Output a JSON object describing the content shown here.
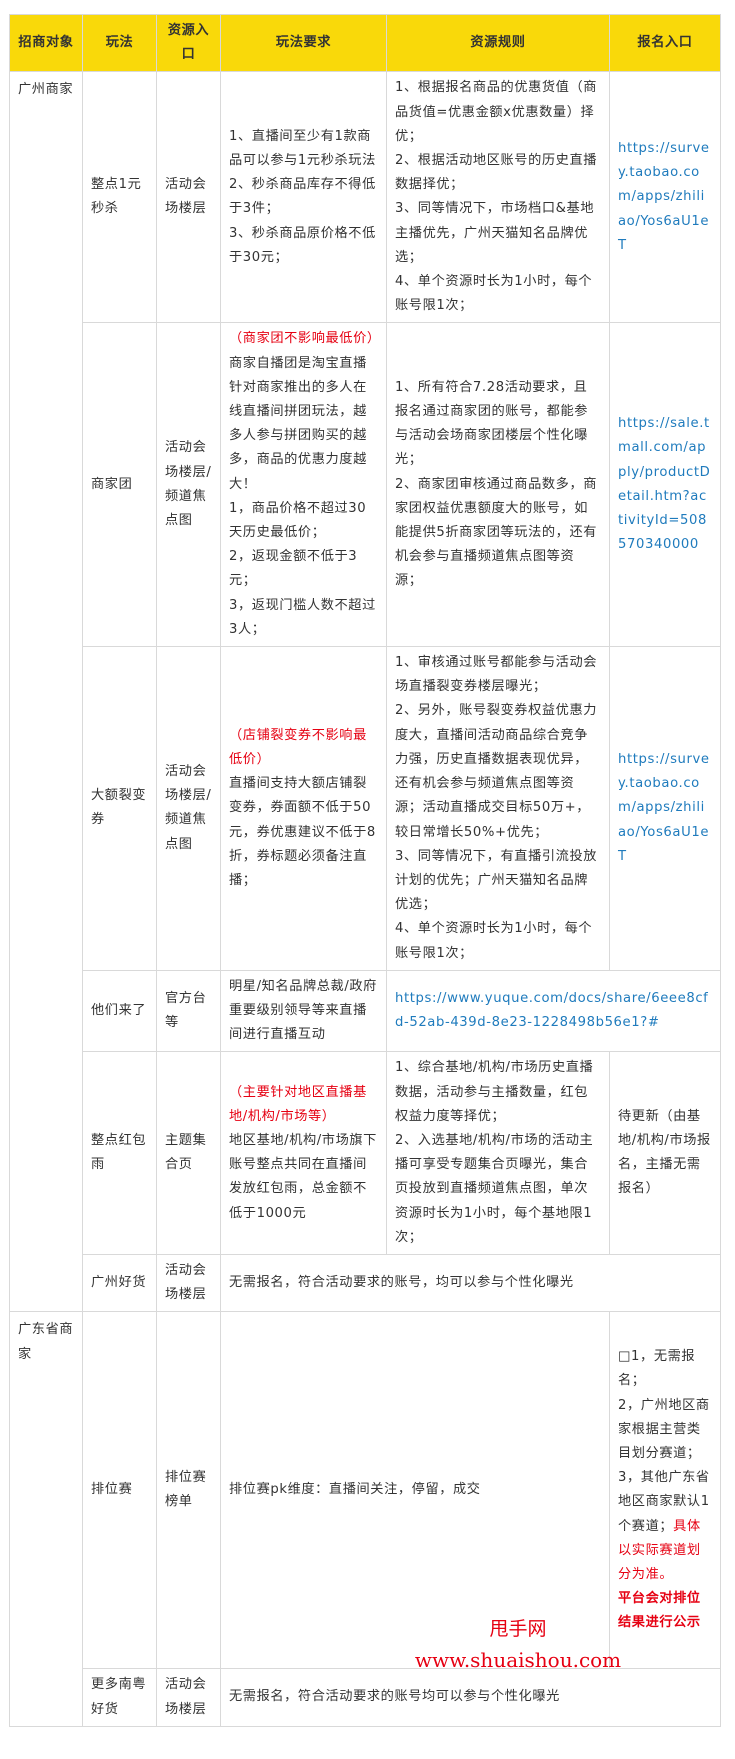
{
  "headers": [
    "招商对象",
    "玩法",
    "资源入口",
    "玩法要求",
    "资源规则",
    "报名入口"
  ],
  "groups": {
    "gz": "广州商家",
    "gd": "广东省商家"
  },
  "rows": [
    {
      "play": "整点1元秒杀",
      "entry": "活动会场楼层",
      "req": [
        "1、直播间至少有1款商品可以参与1元秒杀玩法",
        "2、秒杀商品库存不得低于3件；",
        "3、秒杀商品原价格不低于30元；"
      ],
      "rules": [
        "1、根据报名商品的优惠货值（商品货值=优惠金额x优惠数量）择优；",
        "2、根据活动地区账号的历史直播数据择优；",
        "3、同等情况下，市场档口&基地主播优先，广州天猫知名品牌优选；",
        "4、单个资源时长为1小时，每个账号限1次；"
      ],
      "link": "https://survey.taobao.com/apps/zhiliao/Yos6aU1eT"
    },
    {
      "play": "商家团",
      "entry": "活动会场楼层/频道焦点图",
      "req_note": "（商家团不影响最低价）",
      "req": [
        "商家自播团是淘宝直播针对商家推出的多人在线直播间拼团玩法，越多人参与拼团购买的越多，商品的优惠力度越大！",
        "1，商品价格不超过30天历史最低价；",
        "2，返现金额不低于3元；",
        "3，返现门槛人数不超过3人；"
      ],
      "rules": [
        "1、所有符合7.28活动要求，且报名通过商家团的账号，都能参与活动会场商家团楼层个性化曝光；",
        "2、商家团审核通过商品数多，商家团权益优惠额度大的账号，如能提供5折商家团等玩法的，还有机会参与直播频道焦点图等资源；"
      ],
      "link": "https://sale.tmall.com/apply/productDetail.htm?activityId=508570340000"
    },
    {
      "play": "大额裂变券",
      "entry": "活动会场楼层/频道焦点图",
      "req_note": "（店铺裂变券不影响最低价）",
      "req": [
        "直播间支持大额店铺裂变券，券面额不低于50元，券优惠建议不低于8折，券标题必须备注直播；"
      ],
      "rules": [
        "1、审核通过账号都能参与活动会场直播裂变券楼层曝光；",
        "2、另外，账号裂变券权益优惠力度大，直播间活动商品综合竞争力强，历史直播数据表现优异，还有机会参与频道焦点图等资源；活动直播成交目标50万+，较日常增长50%+优先；",
        "3、同等情况下，有直播引流投放计划的优先；广州天猫知名品牌优选；",
        "4、单个资源时长为1小时，每个账号限1次；"
      ],
      "link": "https://survey.taobao.com/apps/zhiliao/Yos6aU1eT"
    },
    {
      "play": "他们来了",
      "entry": "官方台等",
      "req": [
        "明星/知名品牌总裁/政府重要级别领导等来直播间进行直播互动"
      ],
      "link": "https://www.yuque.com/docs/share/6eee8cfd-52ab-439d-8e23-1228498b56e1?#"
    },
    {
      "play": "整点红包雨",
      "entry": "主题集合页",
      "req_note": "（主要针对地区直播基地/机构/市场等）",
      "req": [
        "地区基地/机构/市场旗下账号整点共同在直播间发放红包雨，总金额不低于1000元"
      ],
      "rules": [
        "1、综合基地/机构/市场历史直播数据，活动参与主播数量，红包权益力度等择优；",
        "2、入选基地/机构/市场的活动主播可享受专题集合页曝光，集合页投放到直播频道焦点图，单次资源时长为1小时，每个基地限1次；"
      ],
      "signup": "待更新（由基地/机构/市场报名，主播无需报名）"
    },
    {
      "play": "广州好货",
      "entry": "活动会场楼层",
      "req": [
        "无需报名，符合活动要求的账号，均可以参与个性化曝光"
      ]
    },
    {
      "play": "排位赛",
      "entry": "排位赛榜单",
      "req": [
        "排位赛pk维度：直播间关注，停留，成交"
      ],
      "signup_lines": [
        "□1，无需报名；",
        "2，广州地区商家根据主营类目划分赛道；",
        "3，其他广东省地区商家默认1个赛道；"
      ],
      "signup_red": "具体以实际赛道划分为准。",
      "signup_bold": "平台会对排位结果进行公示"
    },
    {
      "play": "更多南粤好货",
      "entry": "活动会场楼层",
      "req": [
        "无需报名，符合活动要求的账号均可以参与个性化曝光"
      ]
    }
  ],
  "watermark": {
    "line1": "甩手网",
    "line2": "www.shuaishou.com"
  },
  "colors": {
    "header_bg": "#f9d90a",
    "link": "#1f7bbd",
    "red": "#e60012",
    "border": "#d9d9d9"
  }
}
